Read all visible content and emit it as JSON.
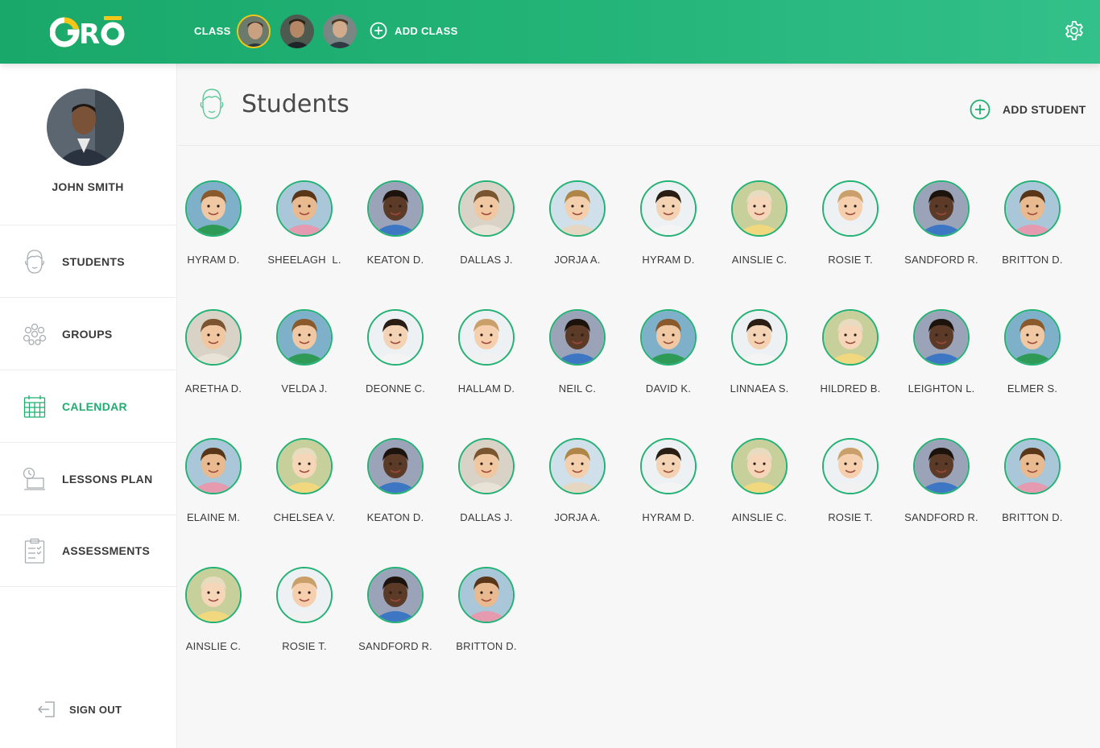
{
  "app": {
    "logo_text": "GRŌ"
  },
  "topbar": {
    "class_label": "CLASS",
    "add_class_label": "ADD CLASS",
    "icons": {
      "add": "plus-circle-icon",
      "settings": "gear-icon"
    }
  },
  "sidebar": {
    "user_name": "JOHN SMITH",
    "items": [
      {
        "label": "STUDENTS",
        "icon": "student-face-icon",
        "active": false
      },
      {
        "label": "GROUPS",
        "icon": "groups-icon",
        "active": false
      },
      {
        "label": "CALENDAR",
        "icon": "calendar-icon",
        "active": true
      },
      {
        "label": "LESSONS PLAN",
        "icon": "lessons-plan-icon",
        "active": false
      },
      {
        "label": "ASSESSMENTS",
        "icon": "assessment-clipboard-icon",
        "active": false
      }
    ],
    "sign_out_label": "SIGN OUT"
  },
  "header": {
    "title": "Students",
    "add_student_label": "ADD STUDENT"
  },
  "students": [
    {
      "name": "HYRAM D."
    },
    {
      "name": "SHEELAGH  L."
    },
    {
      "name": "KEATON D."
    },
    {
      "name": "DALLAS J."
    },
    {
      "name": "JORJA A."
    },
    {
      "name": "HYRAM D."
    },
    {
      "name": "AINSLIE C."
    },
    {
      "name": "ROSIE T."
    },
    {
      "name": "SANDFORD R."
    },
    {
      "name": "BRITTON D."
    },
    {
      "name": "ARETHA D."
    },
    {
      "name": "VELDA J."
    },
    {
      "name": "DEONNE C."
    },
    {
      "name": "HALLAM D."
    },
    {
      "name": "NEIL C."
    },
    {
      "name": "DAVID K."
    },
    {
      "name": "LINNAEA S."
    },
    {
      "name": "HILDRED B."
    },
    {
      "name": "LEIGHTON L."
    },
    {
      "name": "ELMER S."
    },
    {
      "name": "ELAINE M."
    },
    {
      "name": "CHELSEA V."
    },
    {
      "name": "KEATON D."
    },
    {
      "name": "DALLAS J."
    },
    {
      "name": "JORJA A."
    },
    {
      "name": "HYRAM D."
    },
    {
      "name": "AINSLIE C."
    },
    {
      "name": "ROSIE T."
    },
    {
      "name": "SANDFORD R."
    },
    {
      "name": "BRITTON D."
    },
    {
      "name": "AINSLIE C."
    },
    {
      "name": "ROSIE T."
    },
    {
      "name": "SANDFORD R."
    },
    {
      "name": "BRITTON D."
    }
  ],
  "colors": {
    "brand_green": "#1fae6f",
    "logo_yellow": "#f5c518"
  }
}
